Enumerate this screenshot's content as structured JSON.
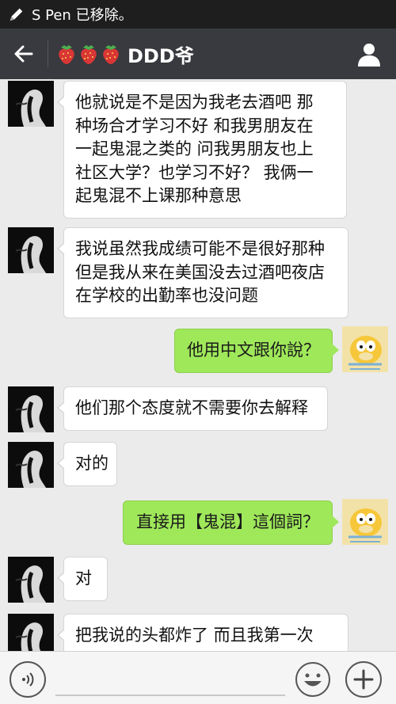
{
  "status_bar": {
    "text": "S Pen 已移除。",
    "icon": "pen-icon"
  },
  "header": {
    "back_icon": "back-arrow-icon",
    "emoji_icons": [
      "strawberry-icon",
      "strawberry-icon",
      "strawberry-icon"
    ],
    "title": "DDD爷",
    "profile_icon": "person-icon"
  },
  "colors": {
    "header_bg": "#393a3f",
    "status_bg": "#1e1e1e",
    "chat_bg": "#ebebeb",
    "outgoing_bubble": "#9fe85a",
    "incoming_bubble": "#ffffff"
  },
  "messages": [
    {
      "from": "them",
      "lines": [
        "他就说是不是因为我老去酒吧 那",
        "种场合才学习不好 和我男朋友在",
        "一起鬼混之类的 问我男朋友也上",
        "社区大学？也学习不好？  我俩一",
        "起鬼混不上课那种意思"
      ]
    },
    {
      "from": "them",
      "lines": [
        "我说虽然我成绩可能不是很好那种",
        "但是我从来在美国没去过酒吧夜店",
        "在学校的出勤率也没问题"
      ]
    },
    {
      "from": "me",
      "lines": [
        "他用中文跟你說？"
      ]
    },
    {
      "from": "them",
      "lines": [
        "他们那个态度就不需要你去解释"
      ]
    },
    {
      "from": "them",
      "lines": [
        "对的"
      ]
    },
    {
      "from": "me",
      "lines": [
        "直接用【鬼混】這個詞？"
      ]
    },
    {
      "from": "them",
      "lines": [
        "对"
      ]
    },
    {
      "from": "them",
      "lines": [
        "把我说的头都炸了 而且我第一次"
      ]
    }
  ],
  "input_bar": {
    "voice_icon": "voice-icon",
    "emoji_icon": "emoji-icon",
    "plus_icon": "plus-icon",
    "input_value": ""
  }
}
